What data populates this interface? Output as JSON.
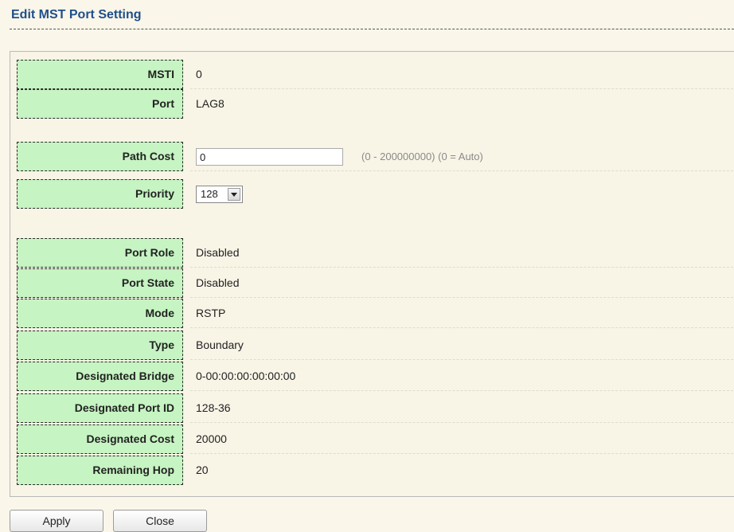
{
  "page": {
    "title": "Edit MST Port Setting"
  },
  "fields": {
    "msti": {
      "label": "MSTI",
      "value": "0"
    },
    "port": {
      "label": "Port",
      "value": "LAG8"
    },
    "path_cost": {
      "label": "Path Cost",
      "value": "0",
      "hint": "(0 - 200000000) (0 = Auto)"
    },
    "priority": {
      "label": "Priority",
      "value": "128"
    },
    "port_role": {
      "label": "Port Role",
      "value": "Disabled"
    },
    "port_state": {
      "label": "Port State",
      "value": "Disabled"
    },
    "mode": {
      "label": "Mode",
      "value": "RSTP"
    },
    "type": {
      "label": "Type",
      "value": "Boundary"
    },
    "designated_bridge": {
      "label": "Designated Bridge",
      "value": "0-00:00:00:00:00:00"
    },
    "designated_port_id": {
      "label": "Designated Port ID",
      "value": "128-36"
    },
    "designated_cost": {
      "label": "Designated Cost",
      "value": "20000"
    },
    "remaining_hop": {
      "label": "Remaining Hop",
      "value": "20"
    }
  },
  "buttons": {
    "apply": "Apply",
    "close": "Close"
  },
  "colors": {
    "label_bg": "#c6f4c2",
    "title": "#1f4f8c",
    "page_bg": "#faf6ea"
  }
}
